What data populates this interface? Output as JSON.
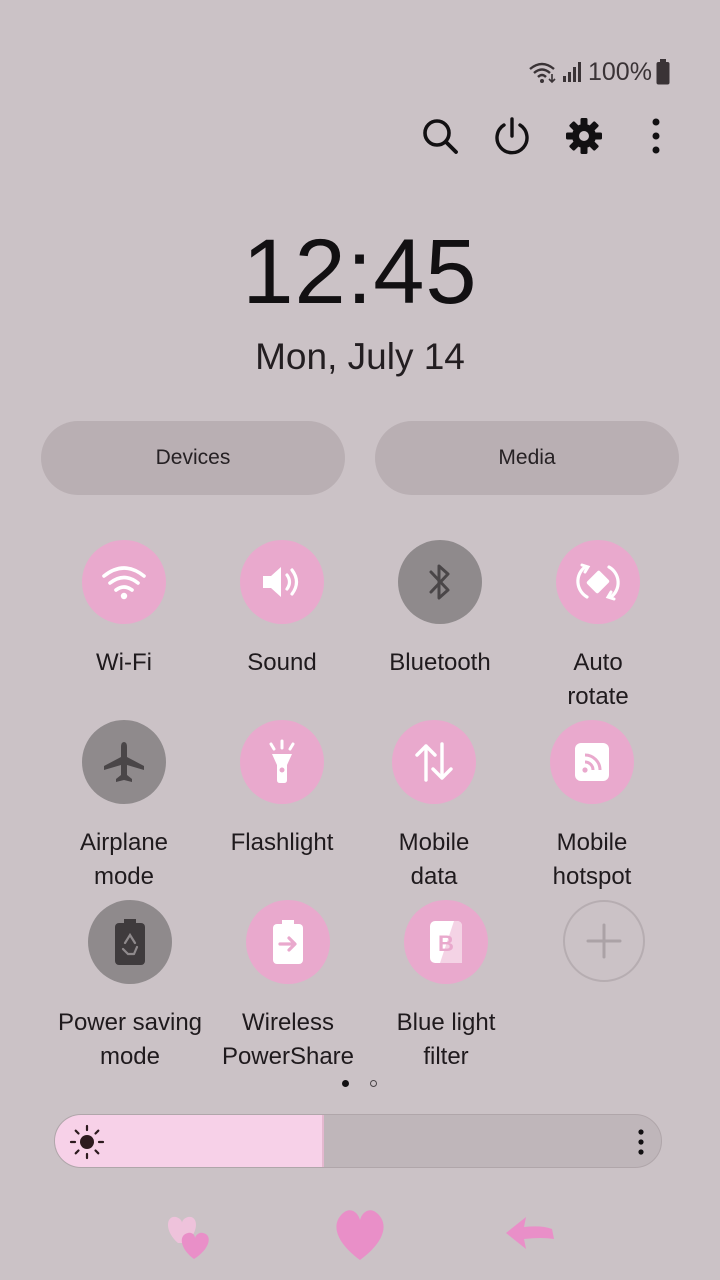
{
  "status_bar": {
    "battery_percent_label": "100%",
    "battery_level": 1.0
  },
  "header": {
    "actions": [
      {
        "name": "search",
        "icon": "search-icon"
      },
      {
        "name": "power",
        "icon": "power-icon"
      },
      {
        "name": "settings",
        "icon": "gear-icon"
      },
      {
        "name": "more",
        "icon": "more-vertical-icon"
      }
    ]
  },
  "clock": {
    "time": "12:45",
    "date": "Mon, July 14"
  },
  "panels": {
    "devices_label": "Devices",
    "media_label": "Media"
  },
  "tiles": [
    {
      "label": "Wi-Fi",
      "icon": "wifi-icon",
      "active": true
    },
    {
      "label": "Sound",
      "icon": "sound-icon",
      "active": true
    },
    {
      "label": "Bluetooth",
      "icon": "bluetooth-icon",
      "active": false
    },
    {
      "label": "Auto\nrotate",
      "icon": "auto-rotate-icon",
      "active": true
    },
    {
      "label": "Airplane\nmode",
      "icon": "airplane-icon",
      "active": false
    },
    {
      "label": "Flashlight",
      "icon": "flashlight-icon",
      "active": true
    },
    {
      "label": "Mobile\ndata",
      "icon": "mobile-data-icon",
      "active": true
    },
    {
      "label": "Mobile\nhotspot",
      "icon": "hotspot-icon",
      "active": true
    },
    {
      "label": "Power saving\nmode",
      "icon": "power-saving-icon",
      "active": false
    },
    {
      "label": "Wireless\nPowerShare",
      "icon": "wireless-powershare-icon",
      "active": true
    },
    {
      "label": "Blue light\nfilter",
      "icon": "blue-light-filter-icon",
      "active": true
    },
    {
      "label": "",
      "icon": "add-icon",
      "active": false
    }
  ],
  "pager": {
    "pages": 2,
    "current": 1
  },
  "brightness": {
    "level": 0.44
  },
  "colors": {
    "background": "#cbc2c6",
    "tile_active": "#e9a9cd",
    "tile_inactive": "#8f8a8c",
    "brightness_fill": "#f7d1e8",
    "accent_pink": "#e98fc8"
  }
}
